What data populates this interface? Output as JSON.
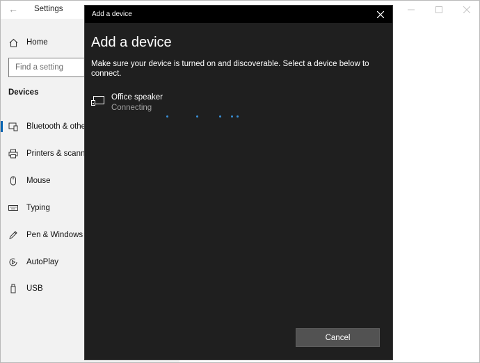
{
  "settings": {
    "title": "Settings",
    "home_label": "Home",
    "search_placeholder": "Find a setting",
    "section_heading": "Devices",
    "nav_items": [
      {
        "label": "Bluetooth & other devices",
        "icon": "bluetooth-devices-icon"
      },
      {
        "label": "Printers & scanners",
        "icon": "printer-icon"
      },
      {
        "label": "Mouse",
        "icon": "mouse-icon"
      },
      {
        "label": "Typing",
        "icon": "keyboard-icon"
      },
      {
        "label": "Pen & Windows Ink",
        "icon": "pen-icon"
      },
      {
        "label": "AutoPlay",
        "icon": "autoplay-icon"
      },
      {
        "label": "USB",
        "icon": "usb-icon"
      }
    ]
  },
  "dialog": {
    "titlebar": "Add a device",
    "heading": "Add a device",
    "description": "Make sure your device is turned on and discoverable. Select a device below to connect.",
    "device": {
      "name": "Office speaker",
      "status": "Connecting",
      "icon": "audio-device-icon"
    },
    "cancel_label": "Cancel"
  },
  "colors": {
    "dialog_bg": "#1f1f1f",
    "titlebar_bg": "#000000",
    "accent": "#3a8fd6",
    "sidebar_bg": "#f2f2f2",
    "button_bg": "#525252"
  }
}
